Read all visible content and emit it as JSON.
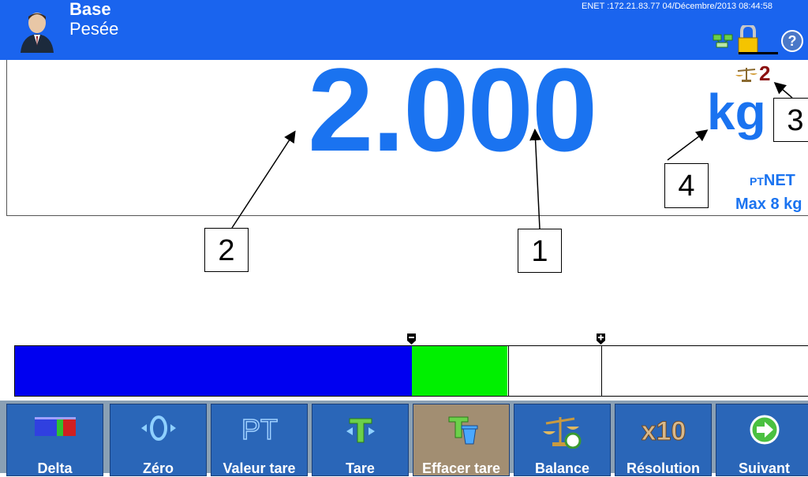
{
  "header": {
    "title": "Base",
    "subtitle": "Pesée",
    "status_line": "ENET :172.21.83.77  04/Décembre/2013 08:44:58",
    "icons": [
      "user-avatar",
      "network-icon",
      "lock-icon",
      "help-icon"
    ]
  },
  "weight": {
    "value": "2.000",
    "unit": "kg",
    "scale_number": "2",
    "mode_prefix": "PT",
    "mode": "NET",
    "capacity": "Max 8 kg"
  },
  "callouts": [
    "1",
    "2",
    "3",
    "4"
  ],
  "bargraph": {
    "fill_fraction": 0.5,
    "tolerance_band": [
      0.5,
      0.62
    ],
    "colors": {
      "fill": "#0000f0",
      "band": "#00f000"
    }
  },
  "softkeys": [
    {
      "label": "Delta",
      "icon": "delta-icon"
    },
    {
      "label": "Zéro",
      "icon": "zero-icon"
    },
    {
      "label": "Valeur tare",
      "icon": "preset-tare-icon"
    },
    {
      "label": "Tare",
      "icon": "tare-icon"
    },
    {
      "label": "Effacer tare",
      "icon": "clear-tare-icon",
      "active": true
    },
    {
      "label": "Balance",
      "icon": "scale-icon"
    },
    {
      "label": "Résolution",
      "icon": "resolution-x10-icon"
    },
    {
      "label": "Suivant",
      "icon": "next-arrow-icon"
    }
  ],
  "colors": {
    "header": "#1a64ee",
    "weight": "#1a73f0",
    "softkey": "#2a66b8"
  }
}
